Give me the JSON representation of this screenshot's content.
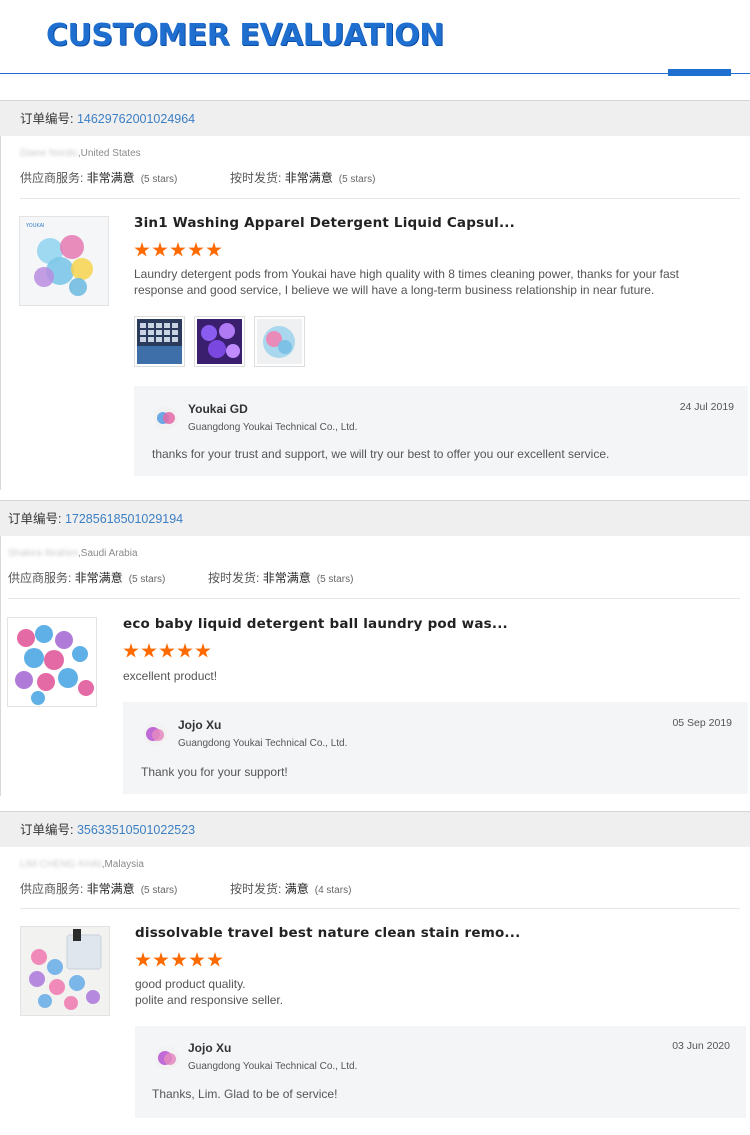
{
  "page": {
    "title": "CUSTOMER EVALUATION"
  },
  "labels": {
    "order_no": "订单编号: ",
    "supplier_service": "供应商服务: ",
    "on_time_delivery": "按时发货: "
  },
  "reviews": [
    {
      "order_number": "14629762001024964",
      "buyer_name_masked": "Diane Nordic",
      "buyer_country": ",United States",
      "supplier_rating": "非常满意",
      "supplier_stars": "(5 stars)",
      "shipping_rating": "非常满意",
      "shipping_stars": "(5 stars)",
      "product_title": "3in1 Washing Apparel Detergent Liquid Capsul...",
      "rating": 5,
      "comment": "Laundry detergent pods from Youkai have high quality with 8 times cleaning power, thanks for your fast response and good service, I believe we will have a long-term business relationship in near future.",
      "photo_icons": [
        "tray-photo",
        "purple-pods-photo",
        "capsule-photo"
      ],
      "reply": {
        "name": "Youkai GD",
        "company": "Guangdong Youkai Technical Co., Ltd.",
        "date": "24 Jul 2019",
        "text": "thanks for your trust and support, we will try our best to offer you our excellent service."
      }
    },
    {
      "order_number": "17285618501029194",
      "buyer_name_masked": "Shakira Ibrahim",
      "buyer_country": ",Saudi Arabia",
      "supplier_rating": "非常满意",
      "supplier_stars": "(5 stars)",
      "shipping_rating": "非常满意",
      "shipping_stars": "(5 stars)",
      "product_title": "eco baby liquid detergent ball laundry pod was...",
      "rating": 5,
      "comment": "excellent product!",
      "reply": {
        "name": "Jojo Xu",
        "company": "Guangdong Youkai Technical Co., Ltd.",
        "date": "05 Sep 2019",
        "text": "Thank you for your support!"
      }
    },
    {
      "order_number": "35633510501022523",
      "buyer_name_masked": "LIM CHENG KHAI",
      "buyer_country": ",Malaysia",
      "supplier_rating": "非常满意",
      "supplier_stars": "(5 stars)",
      "shipping_rating": "满意",
      "shipping_stars": "(4 stars)",
      "product_title": "dissolvable travel best nature clean stain remo...",
      "rating": 5,
      "comment_line1": "good product quality.",
      "comment_line2": "polite and responsive seller.",
      "reply": {
        "name": "Jojo Xu",
        "company": "Guangdong Youkai Technical Co., Ltd.",
        "date": "03 Jun 2020",
        "text": "Thanks, Lim. Glad to be of service!"
      }
    }
  ],
  "colors": {
    "accent": "#1f6fd0",
    "order_number": "#3b7fc4",
    "star": "#ff6a00",
    "reply_bg": "#f4f5f7"
  }
}
